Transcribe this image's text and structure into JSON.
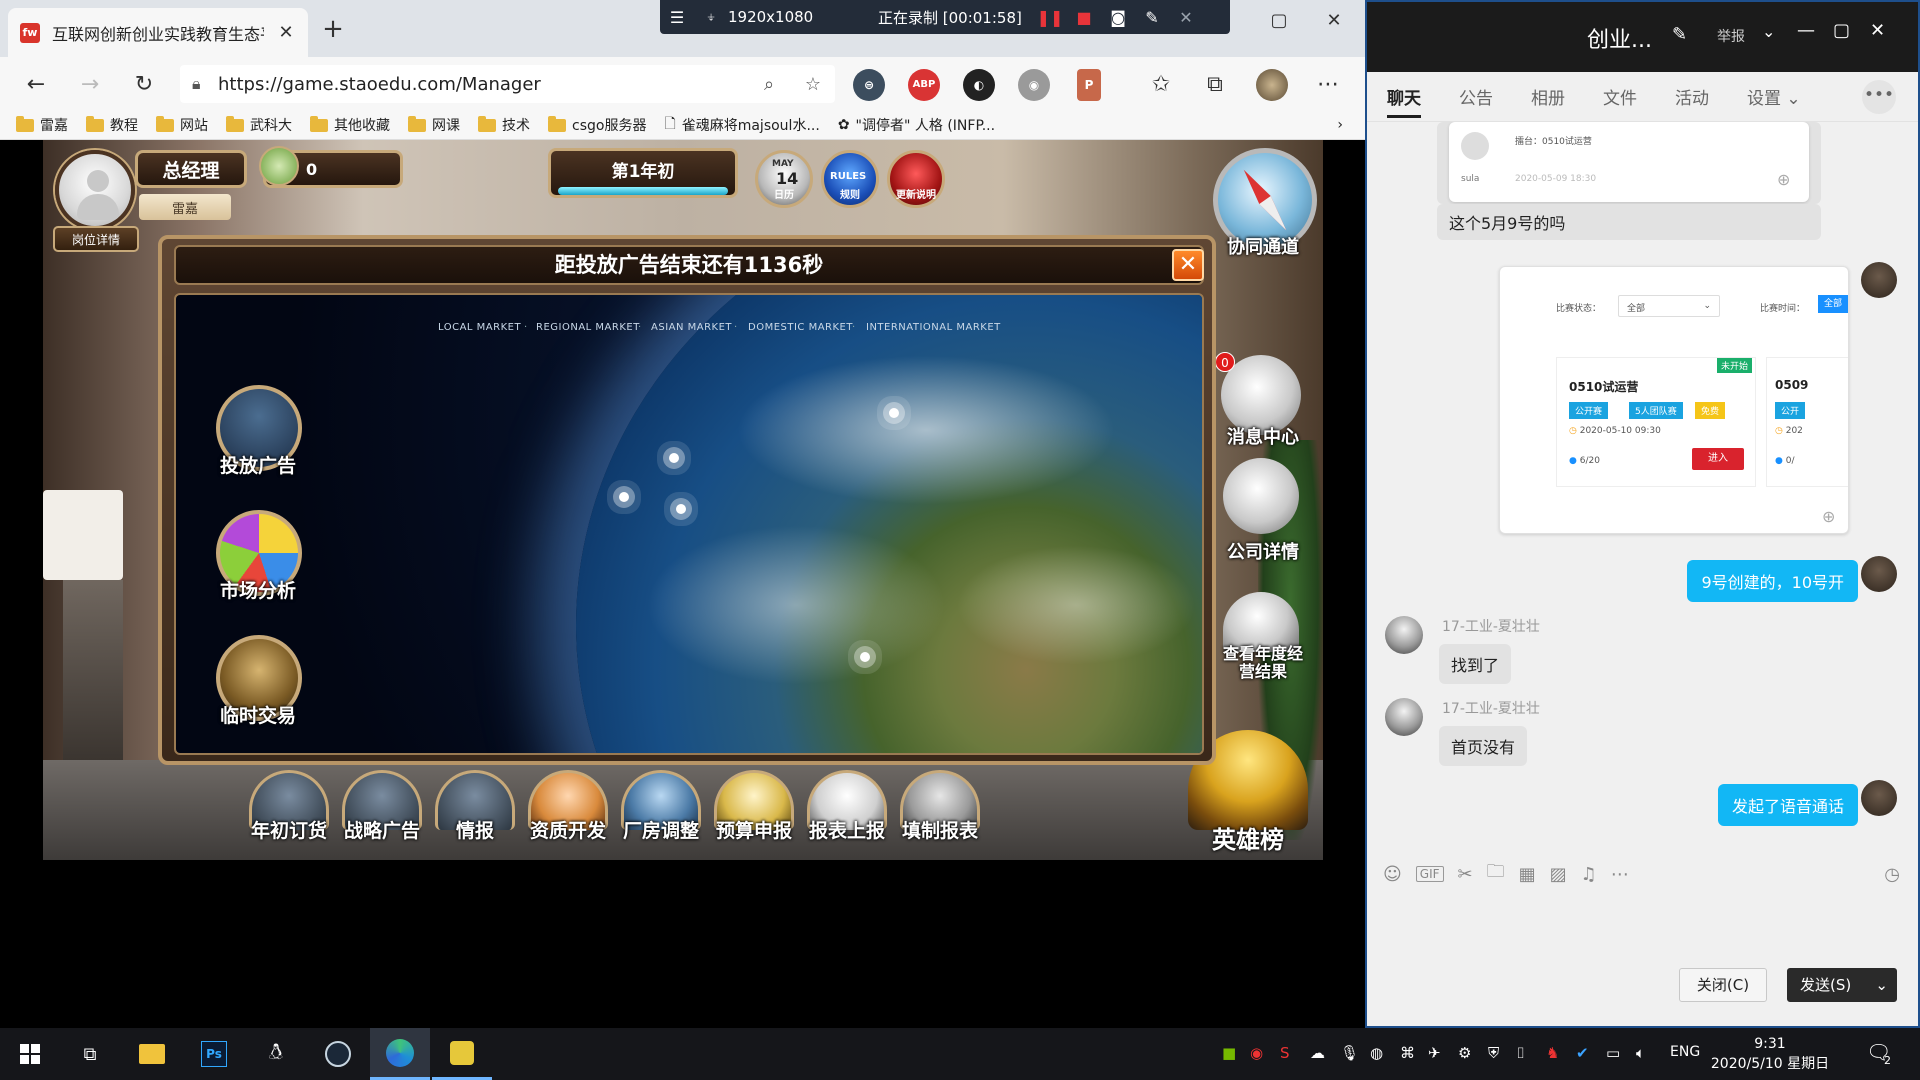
{
  "browser": {
    "tab_title": "互联网创新创业实践教育生态平...",
    "favicon_text": "fw",
    "url": "https://game.staoedu.com/Manager",
    "bookmarks": [
      "雷嘉",
      "教程",
      "网站",
      "武科大",
      "其他收藏",
      "网课",
      "技术",
      "csgo服务器",
      "雀魂麻将majsoul水...",
      "\"调停者\" 人格 (INFP..."
    ],
    "extensions": [
      "ABP"
    ]
  },
  "recorder": {
    "resolution": "1920x1080",
    "status": "正在录制 [00:01:58]"
  },
  "game": {
    "role": "总经理",
    "player_name": "雷嘉",
    "job_details": "岗位详情",
    "money": "0",
    "period": "第1年初",
    "period_progress": 1.0,
    "calendar_day": "14",
    "calendar_month": "MAY",
    "calendar_label": "日历",
    "rules_badge": "RULES",
    "rules_label": "规则",
    "update_label": "更新说明",
    "coop_channel": "协同通道",
    "message_center": "消息中心",
    "message_count": "0",
    "company_details": "公司详情",
    "annual_results": "查看年度经营结果",
    "hero_board": "英雄榜",
    "panel_title": "距投放广告结束还有1136秒",
    "markets": [
      "LOCAL MARKET",
      "REGIONAL MARKET",
      "ASIAN MARKET",
      "DOMESTIC MARKET",
      "INTERNATIONAL MARKET"
    ],
    "left_buttons": [
      "投放广告",
      "市场分析",
      "临时交易"
    ],
    "bottom_buttons": [
      "年初订货",
      "战略广告",
      "情报",
      "资质开发",
      "厂房调整",
      "预算申报",
      "报表上报",
      "填制报表"
    ],
    "colors": {
      "accent_gold": "#c7a97a",
      "panel_brown": "#5f4633",
      "close_orange": "#d44a08"
    }
  },
  "chat": {
    "title": "创业...",
    "report": "举报",
    "tabs": [
      "聊天",
      "公告",
      "相册",
      "文件",
      "活动",
      "设置"
    ],
    "active_tab": "聊天",
    "card1": {
      "label": "擂台：0510试运营",
      "user": "sula",
      "date": "2020-05-09 18:30"
    },
    "msg_question": "这个5月9号的吗",
    "card2": {
      "status_label": "比赛状态：",
      "status_value": "全部",
      "time_label": "比赛时间：",
      "time_value": "全部",
      "badge": "未开始",
      "name": "0510试运营",
      "tags": [
        "公开赛",
        "5人团队赛",
        "免费"
      ],
      "date": "2020-05-10 09:30",
      "count": "6/20",
      "enter": "进入",
      "next_name": "0509",
      "next_tag": "公开",
      "next_date": "202",
      "next_count": "0/"
    },
    "msg_me1": "9号创建的，10号开",
    "sender": "17-工业-夏壮壮",
    "msg_other1": "找到了",
    "msg_other2": "首页没有",
    "msg_me2": "发起了语音通话",
    "close_button": "关闭(C)",
    "send_button": "发送(S)"
  },
  "taskbar": {
    "time": "9:31",
    "date": "2020/5/10 星期日",
    "lang": "ENG",
    "notif_count": "2"
  }
}
